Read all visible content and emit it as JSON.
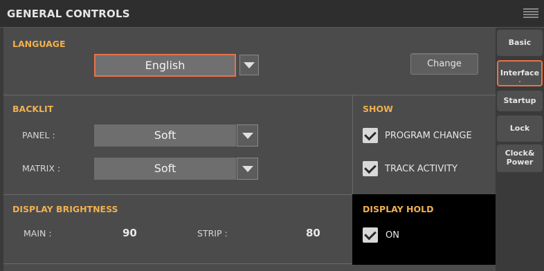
{
  "header": {
    "title": "GENERAL CONTROLS"
  },
  "language": {
    "title": "LANGUAGE",
    "value": "English",
    "change_button": "Change"
  },
  "backlit": {
    "title": "BACKLIT",
    "panel_label": "PANEL :",
    "panel_value": "Soft",
    "matrix_label": "MATRIX :",
    "matrix_value": "Soft"
  },
  "show": {
    "title": "SHOW",
    "program_change": "PROGRAM CHANGE",
    "track_activity": "TRACK ACTIVITY"
  },
  "brightness": {
    "title": "DISPLAY BRIGHTNESS",
    "main_label": "MAIN :",
    "main_value": "90",
    "strip_label": "STRIP :",
    "strip_value": "80"
  },
  "hold": {
    "title": "DISPLAY HOLD",
    "on_label": "ON"
  },
  "tabs": [
    {
      "label": "Basic"
    },
    {
      "label": "Interface"
    },
    {
      "label": "Startup"
    },
    {
      "label": "Lock"
    },
    {
      "label": "Clock&\nPower"
    }
  ],
  "colors": {
    "accent": "#f0b050",
    "selection": "#e8734a"
  },
  "icons": {
    "menu": "menu-icon",
    "dropdown": "triangle-down-icon",
    "check": "checkmark-icon"
  }
}
